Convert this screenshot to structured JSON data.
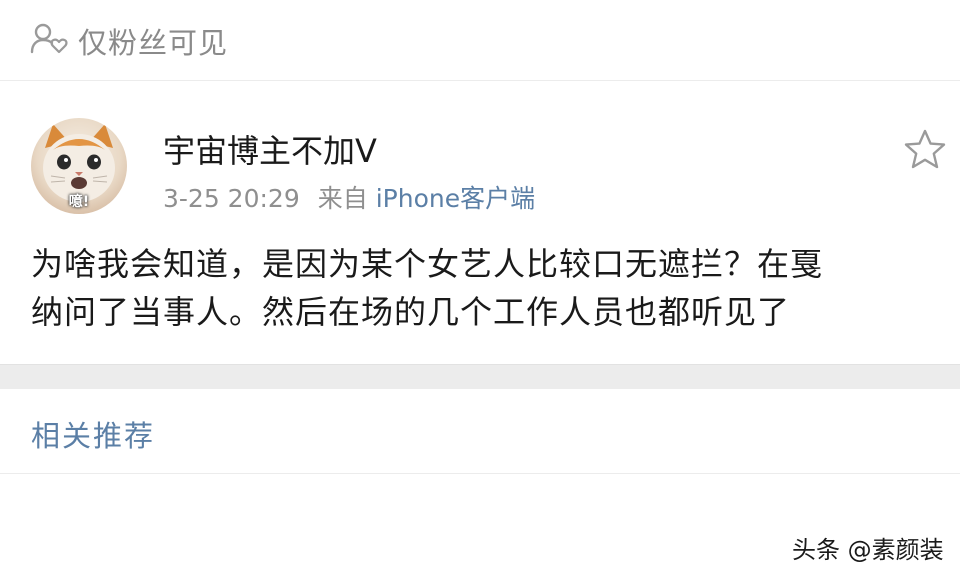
{
  "visibility": {
    "label": "仅粉丝可见",
    "icon": "fans-only-icon"
  },
  "post": {
    "author": "宇宙博主不加V",
    "avatar_caption": "噫!",
    "timestamp": "3-25 20:29",
    "source_prefix": "来自",
    "source": "iPhone客户端",
    "body_line1": "为啥我会知道，是因为某个女艺人比较口无遮拦？在戛",
    "body_line2": "纳问了当事人。然后在场的几个工作人员也都听见了"
  },
  "related": {
    "title": "相关推荐"
  },
  "watermark": "头条 @素颜装",
  "colors": {
    "link": "#5b7fa6",
    "muted": "#8f8f8f",
    "divider": "#ececec"
  }
}
